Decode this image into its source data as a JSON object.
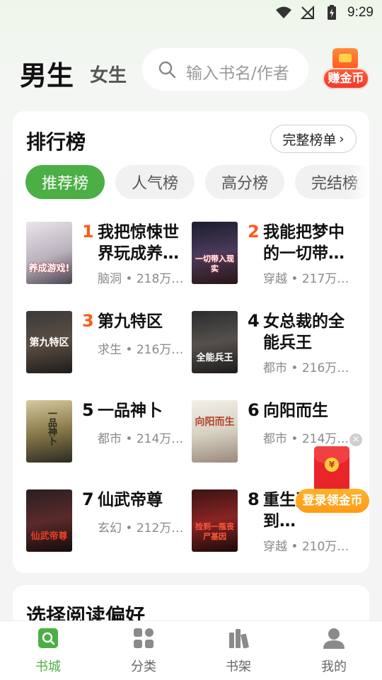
{
  "status_bar": {
    "time": "9:29",
    "icons": [
      "wifi-icon",
      "no-signal-icon",
      "battery-charging-icon"
    ]
  },
  "header": {
    "tab_male": "男生",
    "tab_female": "女生",
    "search_placeholder": "输入书名/作者",
    "coin_button_label": "赚金币"
  },
  "ranking": {
    "title": "排行榜",
    "full_list_label": "完整榜单",
    "tabs": [
      "推荐榜",
      "人气榜",
      "高分榜",
      "完结榜"
    ],
    "active_tab": 0,
    "books": [
      {
        "rank": "1",
        "title": "我把惊悚世界玩成养…",
        "meta": "脑洞 • 218万…",
        "cover_text": "养成游戏!"
      },
      {
        "rank": "2",
        "title": "我能把梦中的一切带…",
        "meta": "穿越 • 217万…",
        "cover_text": "一切带入现实"
      },
      {
        "rank": "3",
        "title": "第九特区",
        "meta": "求生 • 216万…",
        "cover_text": "第九特区"
      },
      {
        "rank": "4",
        "title": "女总裁的全能兵王",
        "meta": "都市 • 216万…",
        "cover_text": "全能兵王"
      },
      {
        "rank": "5",
        "title": "一品神卜",
        "meta": "都市 • 214万…",
        "cover_text": "一品神卜"
      },
      {
        "rank": "6",
        "title": "向阳而生",
        "meta": "都市 • 214万…",
        "cover_text": "向阳而生"
      },
      {
        "rank": "7",
        "title": "仙武帝尊",
        "meta": "玄幻 • 212万…",
        "cover_text": "仙武帝尊"
      },
      {
        "rank": "8",
        "title": "重生开局捡到…",
        "meta": "穿越 • 210万…",
        "cover_text": "捡到一瓶丧尸基因"
      }
    ]
  },
  "preferences": {
    "title": "选择阅读偏好"
  },
  "floating": {
    "red_packet_label": "登录领金币",
    "close": "×",
    "coin_symbol": "¥"
  },
  "bottom_nav": [
    {
      "label": "书城",
      "icon": "bookstore-icon",
      "active": true
    },
    {
      "label": "分类",
      "icon": "category-icon",
      "active": false
    },
    {
      "label": "书架",
      "icon": "bookshelf-icon",
      "active": false
    },
    {
      "label": "我的",
      "icon": "profile-icon",
      "active": false
    }
  ],
  "colors": {
    "accent_green": "#4caf46",
    "rank_orange": "#ff5a1a",
    "coin_red": "#f03a2a",
    "red_packet_orange": "#ff9b14"
  }
}
